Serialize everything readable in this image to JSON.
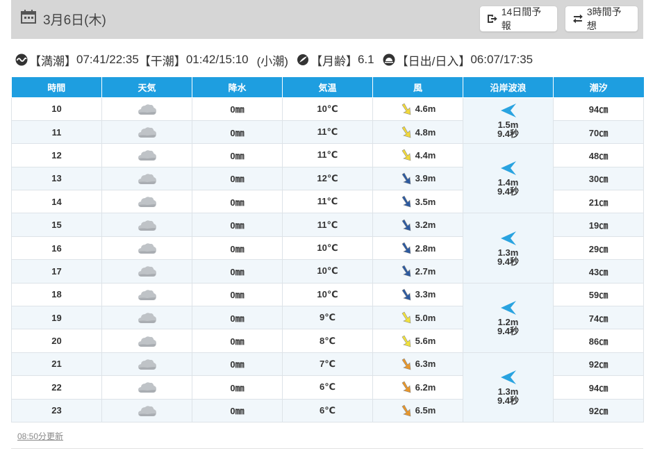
{
  "header": {
    "date": "3月6日(木)",
    "btn_14day": "14日間予報",
    "btn_3hour": "3時間予想"
  },
  "info": {
    "high_tide_label": "【満潮】",
    "high_tide_value": "07:41/22:35",
    "low_tide_label": "【干潮】",
    "low_tide_value": "01:42/15:10",
    "tide_type": "(小潮)",
    "moon_label": "【月齢】",
    "moon_value": "6.1",
    "sun_label": "【日出/日入】",
    "sun_value": "06:07/17:35"
  },
  "table": {
    "headers": [
      "時間",
      "天気",
      "降水",
      "気温",
      "風",
      "沿岸波浪",
      "潮汐"
    ],
    "rows": [
      {
        "hour": "10",
        "precip": "0㎜",
        "temp": "10℃",
        "wind": "4.6m",
        "wind_color": "#f2d93a",
        "tide": "94㎝"
      },
      {
        "hour": "11",
        "precip": "0㎜",
        "temp": "11℃",
        "wind": "4.8m",
        "wind_color": "#f2d93a",
        "tide": "70㎝"
      },
      {
        "hour": "12",
        "precip": "0㎜",
        "temp": "11℃",
        "wind": "4.4m",
        "wind_color": "#f2d93a",
        "tide": "48㎝"
      },
      {
        "hour": "13",
        "precip": "0㎜",
        "temp": "12℃",
        "wind": "3.9m",
        "wind_color": "#2c5aa0",
        "tide": "30㎝"
      },
      {
        "hour": "14",
        "precip": "0㎜",
        "temp": "11℃",
        "wind": "3.5m",
        "wind_color": "#2c5aa0",
        "tide": "21㎝"
      },
      {
        "hour": "15",
        "precip": "0㎜",
        "temp": "11℃",
        "wind": "3.2m",
        "wind_color": "#2c5aa0",
        "tide": "19㎝"
      },
      {
        "hour": "16",
        "precip": "0㎜",
        "temp": "10℃",
        "wind": "2.8m",
        "wind_color": "#2c5aa0",
        "tide": "29㎝"
      },
      {
        "hour": "17",
        "precip": "0㎜",
        "temp": "10℃",
        "wind": "2.7m",
        "wind_color": "#2c5aa0",
        "tide": "43㎝"
      },
      {
        "hour": "18",
        "precip": "0㎜",
        "temp": "10℃",
        "wind": "3.3m",
        "wind_color": "#2c5aa0",
        "tide": "59㎝"
      },
      {
        "hour": "19",
        "precip": "0㎜",
        "temp": "9℃",
        "wind": "5.0m",
        "wind_color": "#f2e23a",
        "tide": "74㎝"
      },
      {
        "hour": "20",
        "precip": "0㎜",
        "temp": "8℃",
        "wind": "5.6m",
        "wind_color": "#f2e23a",
        "tide": "86㎝"
      },
      {
        "hour": "21",
        "precip": "0㎜",
        "temp": "7℃",
        "wind": "6.3m",
        "wind_color": "#e8962a",
        "tide": "92㎝"
      },
      {
        "hour": "22",
        "precip": "0㎜",
        "temp": "6℃",
        "wind": "6.2m",
        "wind_color": "#e8962a",
        "tide": "94㎝"
      },
      {
        "hour": "23",
        "precip": "0㎜",
        "temp": "6℃",
        "wind": "6.5m",
        "wind_color": "#e8962a",
        "tide": "92㎝"
      }
    ],
    "waves": [
      {
        "height": "1.5m",
        "period": "9.4秒",
        "rows": 2
      },
      {
        "height": "1.4m",
        "period": "9.4秒",
        "rows": 3
      },
      {
        "height": "1.3m",
        "period": "9.4秒",
        "rows": 3
      },
      {
        "height": "1.2m",
        "period": "9.4秒",
        "rows": 3
      },
      {
        "height": "1.3m",
        "period": "9.4秒",
        "rows": 3
      }
    ]
  },
  "footer": {
    "updated": "08:50分更新"
  },
  "colors": {
    "header_bg": "#d6d6d6",
    "table_header": "#1e9ee0",
    "wave_arrow": "#29a3e0"
  },
  "icons": {
    "calendar": "calendar-icon",
    "forecast14": "export-icon",
    "forecast3": "swap-icon",
    "tide": "tide-icon",
    "moon": "moon-icon",
    "sun": "sunrise-icon",
    "weather": "cloud-icon"
  }
}
